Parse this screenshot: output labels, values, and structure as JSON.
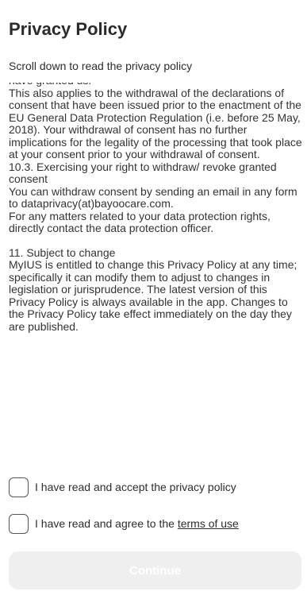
{
  "header": {
    "title": "Privacy Policy",
    "subtitle": "Scroll down to read the privacy policy"
  },
  "policy": {
    "block1": "have granted us.\nThis also applies to the withdrawal of the declarations of consent that have been issued prior to the enactment of the EU General Data Protection Regulation (i.e. before 25 May, 2018). Your withdrawal of consent has no further implications for the legality of the processing that took place at your consent prior to your withdrawal of consent.\n10.3. Exercising your right to withdraw/ revoke granted consent\nYou can withdraw consent by sending an email in any form to dataprivacy(at)bayoocare.com.\nFor any matters related to your data protection rights, directly contact the data protection officer.",
    "block2": "11. Subject to change\nMyIUS is entitled to change this Privacy Policy at any time; specifically it can modify them to adjust to changes in legislation or jurisprudence. The latest version of this Privacy Policy is always available in the app. Changes to the Privacy Policy take effect immediately on the day they are published."
  },
  "consent": {
    "privacy_label": "I have read and accept the privacy policy",
    "terms_prefix": "I have read and agree to the ",
    "terms_link": "terms of use",
    "privacy_checked": false,
    "terms_checked": false
  },
  "actions": {
    "continue_label": "Continue",
    "continue_enabled": false
  },
  "colors": {
    "text": "#2d2d2d",
    "button_disabled_bg": "#efefef",
    "button_disabled_text": "#ffffff"
  }
}
